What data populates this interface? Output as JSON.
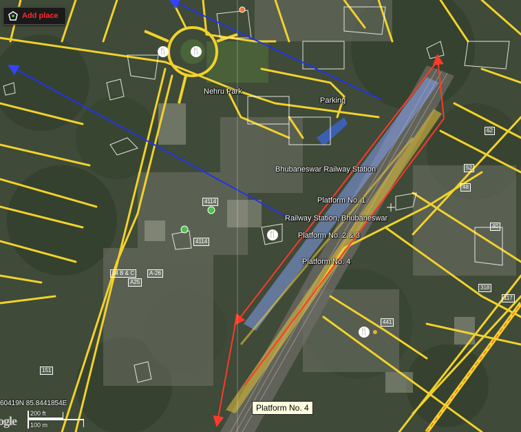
{
  "toolbar": {
    "add_place_label": "Add place"
  },
  "places": {
    "nehru_park": "Nehru Park",
    "parking": "Parking",
    "station": "Bhubaneswar Railway Station",
    "platform1": "Platform No. 1",
    "station_alt": "Railway Station, Bhubaneswar",
    "platform23": "Platform No. 2 & 3",
    "platform4": "Platform No. 4"
  },
  "plot_numbers": {
    "n4114a": "4114",
    "n4114b": "4114",
    "n54bc": "54 B & C",
    "na26": "A-26",
    "na25": "A25",
    "n151": "151",
    "n62": "62",
    "n52": "52",
    "n48": "48",
    "n40": "40",
    "n318": "318",
    "n117": "117",
    "n441": "441"
  },
  "callout": {
    "label": "Platform No. 4"
  },
  "status": {
    "coordinates": "60419N 85.8441854E"
  },
  "scale": {
    "feet": "200 ft",
    "meters": "100 m"
  },
  "logo": {
    "text": "ogle"
  },
  "colors": {
    "roads": "#f2d22b",
    "annotation_arrow": "#ff3a2a",
    "blue_arrows": "#2233ee",
    "platform_blue": "#8aa6ff",
    "platform_yellow": "#e6c23a"
  },
  "icons": [
    "add-place-icon",
    "restaurant-icon",
    "marker-icon",
    "crosshair-icon"
  ]
}
